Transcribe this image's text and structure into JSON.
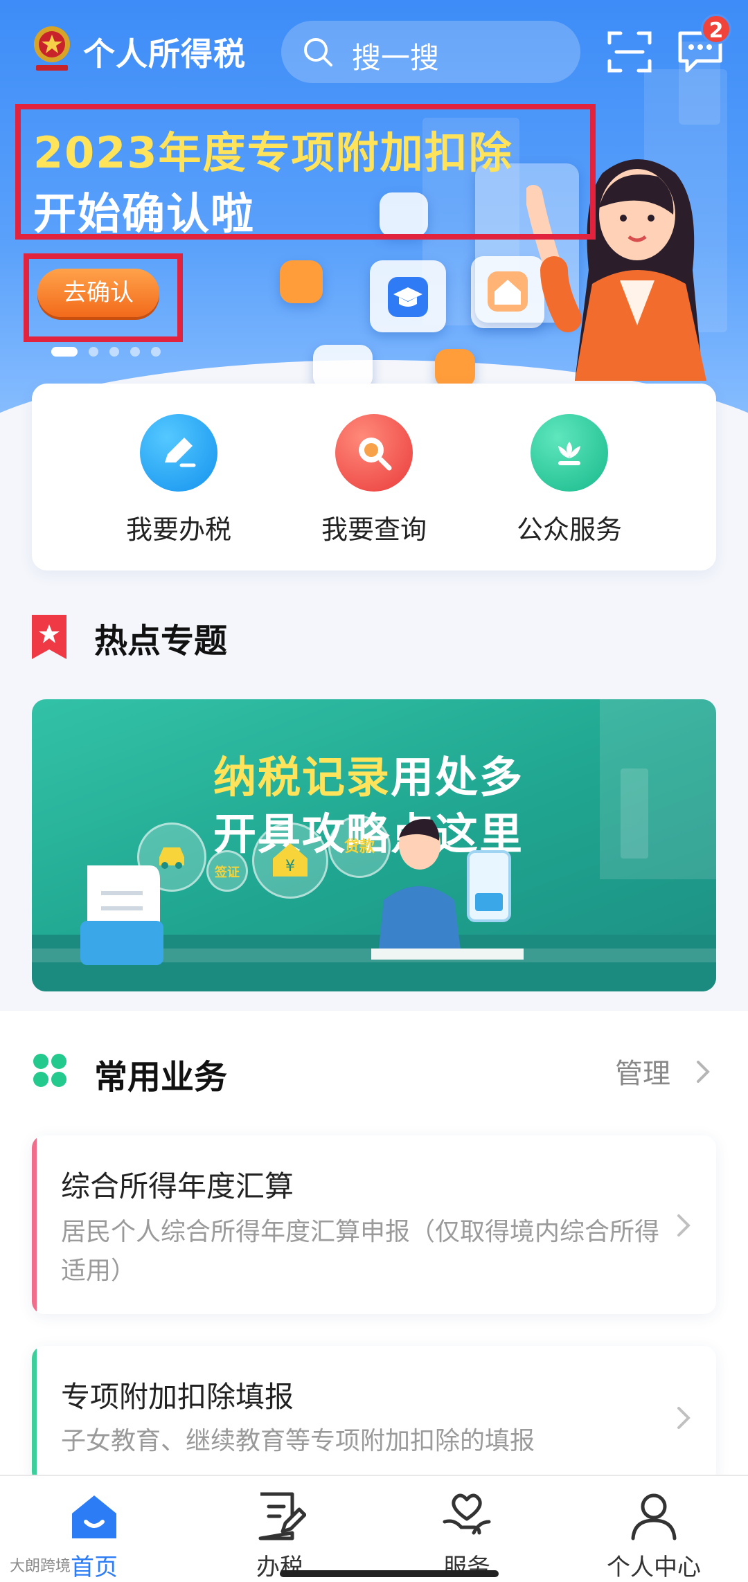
{
  "header": {
    "app_title": "个人所得税",
    "search_placeholder": "搜一搜",
    "message_badge": "2"
  },
  "banner": {
    "title_part1": "2023年度",
    "title_highlight": "专项附加扣除",
    "title_line2": "开始确认啦",
    "confirm_label": "去确认",
    "slides_total": 5,
    "slide_active": 1
  },
  "quick_actions": [
    {
      "label": "我要办税",
      "icon": "edit-icon",
      "color": "#1da1f2"
    },
    {
      "label": "我要查询",
      "icon": "search-icon",
      "color": "#f04a4a"
    },
    {
      "label": "公众服务",
      "icon": "flower-icon",
      "color": "#1fc29a"
    }
  ],
  "hot_topics": {
    "title": "热点专题",
    "banner_highlight": "纳税记录",
    "banner_line1_rest": "用处多",
    "banner_line2": "开具攻略点这里",
    "bubble_loan": "贷款",
    "bubble_visa": "签证"
  },
  "common": {
    "title": "常用业务",
    "manage_label": "管理",
    "items": [
      {
        "title": "综合所得年度汇算",
        "desc": "居民个人综合所得年度汇算申报（仅取得境内综合所得适用）",
        "accent": "#f06d8b"
      },
      {
        "title": "专项附加扣除填报",
        "desc": "子女教育、继续教育等专项附加扣除的填报",
        "accent": "#3ccf9c"
      }
    ]
  },
  "tabbar": {
    "tabs": [
      {
        "label": "首页",
        "icon": "home-icon",
        "active": true
      },
      {
        "label": "办税",
        "icon": "document-edit-icon",
        "active": false
      },
      {
        "label": "服务",
        "icon": "heart-hand-icon",
        "active": false
      },
      {
        "label": "个人中心",
        "icon": "person-icon",
        "active": false
      }
    ]
  },
  "watermark": "大朗跨境",
  "colors": {
    "primary": "#2c7cf6",
    "highlight": "#ffe35a",
    "annotation": "#e2233d"
  }
}
